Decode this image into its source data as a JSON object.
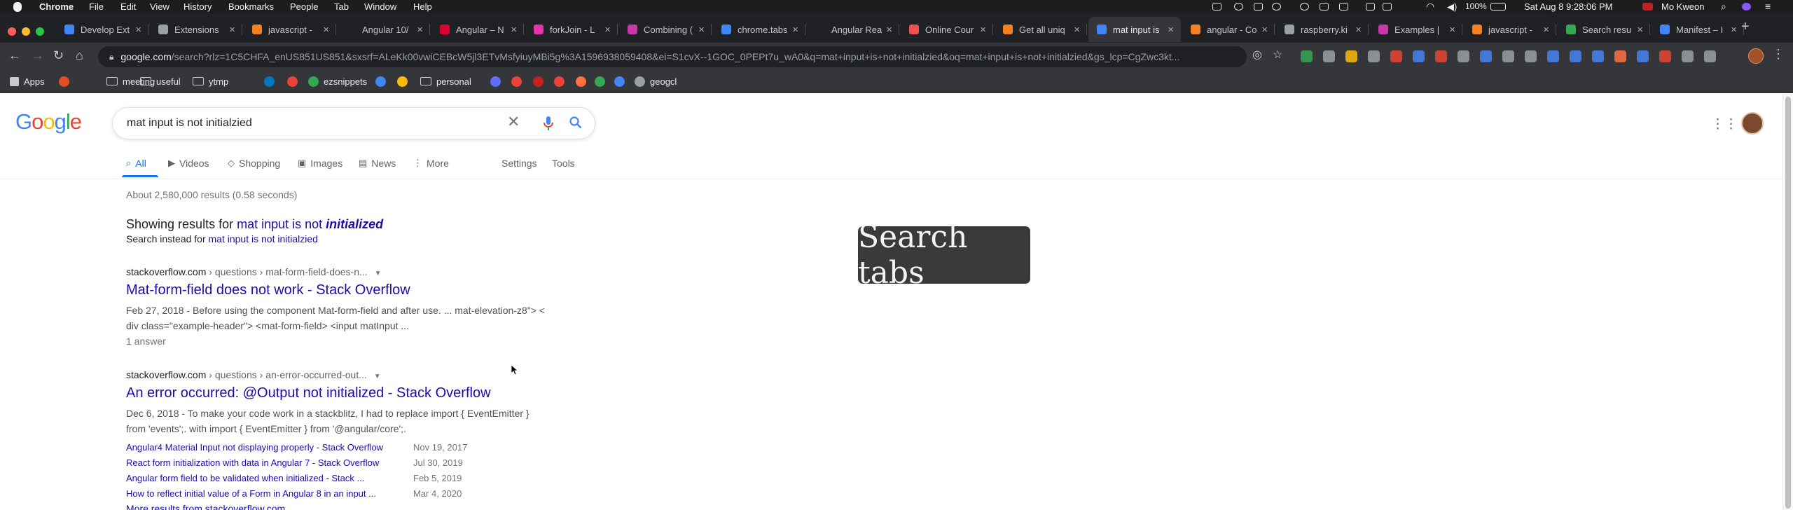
{
  "menubar": {
    "app": "Chrome",
    "items": [
      "File",
      "Edit",
      "View",
      "History",
      "Bookmarks",
      "People",
      "Tab",
      "Window",
      "Help"
    ],
    "battery": "100%",
    "datetime": "Sat Aug 8  9:28:06 PM",
    "user": "Mo Kweon"
  },
  "browser": {
    "tabs": [
      {
        "title": "Develop Ext",
        "color": "#4285f4"
      },
      {
        "title": "Extensions",
        "color": "#9aa0a6"
      },
      {
        "title": "javascript -",
        "color": "#f48024"
      },
      {
        "title": "Angular 10/",
        "color": "#202124"
      },
      {
        "title": "Angular – N",
        "color": "#dd0031"
      },
      {
        "title": "forkJoin - L",
        "color": "#e535ab"
      },
      {
        "title": "Combining (",
        "color": "#c837ab"
      },
      {
        "title": "chrome.tabs",
        "color": "#4285f4"
      },
      {
        "title": "Angular Rea",
        "color": "#202124"
      },
      {
        "title": "Online Cour",
        "color": "#ec5252"
      },
      {
        "title": "Get all uniq",
        "color": "#f48024"
      },
      {
        "title": "mat input is",
        "color": "#4285f4",
        "active": true
      },
      {
        "title": "angular - Co",
        "color": "#f48024"
      },
      {
        "title": "raspberry.ki",
        "color": "#9aa0a6"
      },
      {
        "title": "Examples |",
        "color": "#c837ab"
      },
      {
        "title": "javascript -",
        "color": "#f48024"
      },
      {
        "title": "Search resu",
        "color": "#34a853"
      },
      {
        "title": "Manifest – I",
        "color": "#4285f4"
      }
    ],
    "new_tab": "+",
    "url_domain": "google.com",
    "url_rest": "/search?rlz=1C5CHFA_enUS851US851&sxsrf=ALeKk00vwiCEBcW5jl3ETvMsfyiuyMBi5g%3A1596938059408&ei=S1cvX--1GOC_0PEPt7u_wA0&q=mat+input+is+not+initialzied&oq=mat+input+is+not+initialzied&gs_lcp=CgZwc3kt..."
  },
  "bookmarks": [
    {
      "label": "Apps",
      "kind": "apps"
    },
    {
      "label": "",
      "color": "#e34c26"
    },
    {
      "label": "meeting",
      "kind": "folder"
    },
    {
      "label": "useful",
      "kind": "folder"
    },
    {
      "label": "ytmp",
      "kind": "folder"
    },
    {
      "label": "",
      "color": "#0079bf"
    },
    {
      "label": "",
      "color": "#ea4335"
    },
    {
      "label": "ezsnippets",
      "color": "#34a853"
    },
    {
      "label": "",
      "color": "#4285f4"
    },
    {
      "label": "",
      "color": "#fbbc05"
    },
    {
      "label": "personal",
      "kind": "folder"
    },
    {
      "label": "",
      "color": "#5f6dff"
    },
    {
      "label": "",
      "color": "#ea4335"
    },
    {
      "label": "",
      "color": "#c5221f"
    },
    {
      "label": "",
      "color": "#ea4335"
    },
    {
      "label": "",
      "color": "#ff7043"
    },
    {
      "label": "",
      "color": "#34a853"
    },
    {
      "label": "",
      "color": "#4285f4"
    },
    {
      "label": "geogcl",
      "color": "#9aa0a6"
    }
  ],
  "google": {
    "logo": "Google",
    "query": "mat input is not initialzied",
    "tabs": [
      {
        "label": "All",
        "icon": "⌕",
        "active": true
      },
      {
        "label": "Videos",
        "icon": "▶"
      },
      {
        "label": "Shopping",
        "icon": "◇"
      },
      {
        "label": "Images",
        "icon": "▣"
      },
      {
        "label": "News",
        "icon": "▤"
      },
      {
        "label": "More",
        "icon": "⋮"
      }
    ],
    "settings": "Settings",
    "tools": "Tools",
    "stats": "About 2,580,000 results (0.58 seconds)",
    "showing_prefix": "Showing results for ",
    "corrected_plain": "mat input is not ",
    "corrected_bold": "initialized",
    "instead_prefix": "Search instead for ",
    "instead_query": "mat input is not initialzied",
    "results": [
      {
        "domain": "stackoverflow.com",
        "path": " › questions › mat-form-field-does-n...",
        "title": "Mat-form-field does not work - Stack Overflow",
        "snippet1": "Feb 27, 2018 - Before using the component Mat-form-field and after use. ... mat-elevation-z8\"> <",
        "snippet2": "div class=\"example-header\"> <mat-form-field> <input matInput ...",
        "extra": "1 answer"
      },
      {
        "domain": "stackoverflow.com",
        "path": " › questions › an-error-occurred-out...",
        "title": "An error occurred: @Output not initialized - Stack Overflow",
        "snippet1": "Dec 6, 2018 - To make your code work in a stackblitz, I had to replace import { EventEmitter }",
        "snippet2": "from 'events';. with import { EventEmitter } from '@angular/core';.",
        "sitelinks": [
          {
            "text": "Angular4 Material Input not displaying properly - Stack Overflow",
            "date": "Nov 19, 2017"
          },
          {
            "text": "React form initialization with data in Angular 7 - Stack Overflow",
            "date": "Jul 30, 2019"
          },
          {
            "text": "Angular form field to be validated when initialized - Stack ...",
            "date": "Feb 5, 2019"
          },
          {
            "text": "How to reflect initial value of a Form in Angular 8 in an input ...",
            "date": "Mar 4, 2020"
          }
        ],
        "more": "More results from stackoverflow.com"
      }
    ]
  },
  "overlay": {
    "label": "Search tabs"
  }
}
